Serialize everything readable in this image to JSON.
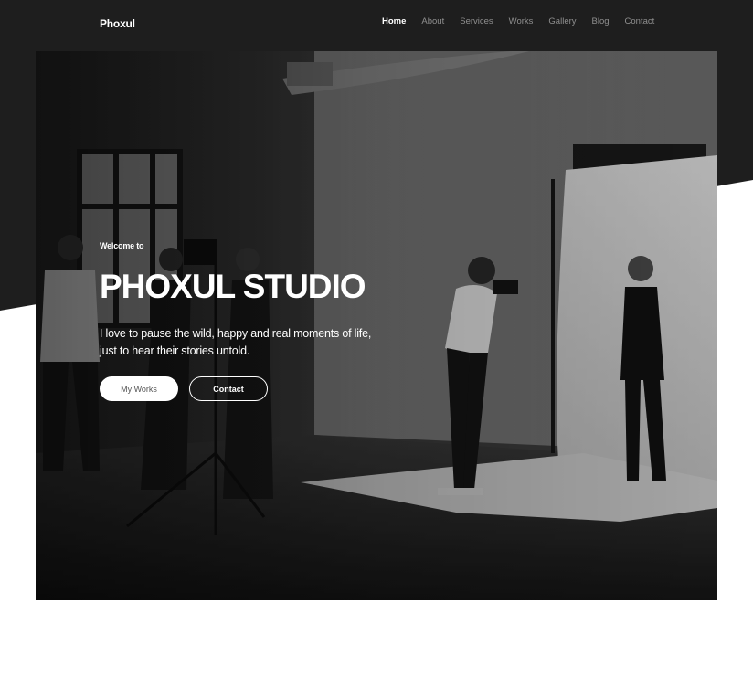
{
  "nav": {
    "brand": "Phoxul",
    "items": [
      {
        "label": "Home",
        "active": true
      },
      {
        "label": "About",
        "active": false
      },
      {
        "label": "Services",
        "active": false
      },
      {
        "label": "Works",
        "active": false
      },
      {
        "label": "Gallery",
        "active": false
      },
      {
        "label": "Blog",
        "active": false
      },
      {
        "label": "Contact",
        "active": false
      }
    ]
  },
  "hero": {
    "eyebrow": "Welcome to",
    "title": "PHOXUL STUDIO",
    "tagline_line1": "I love to pause the wild, happy and real moments of life,",
    "tagline_line2": "just to hear their stories untold.",
    "primary_button": "My Works",
    "secondary_button": "Contact",
    "image": "black-and-white photo studio shoot"
  },
  "colors": {
    "dark_background": "#1e1e1e",
    "nav_text": "#8f8f8f",
    "text_white": "#ffffff"
  }
}
